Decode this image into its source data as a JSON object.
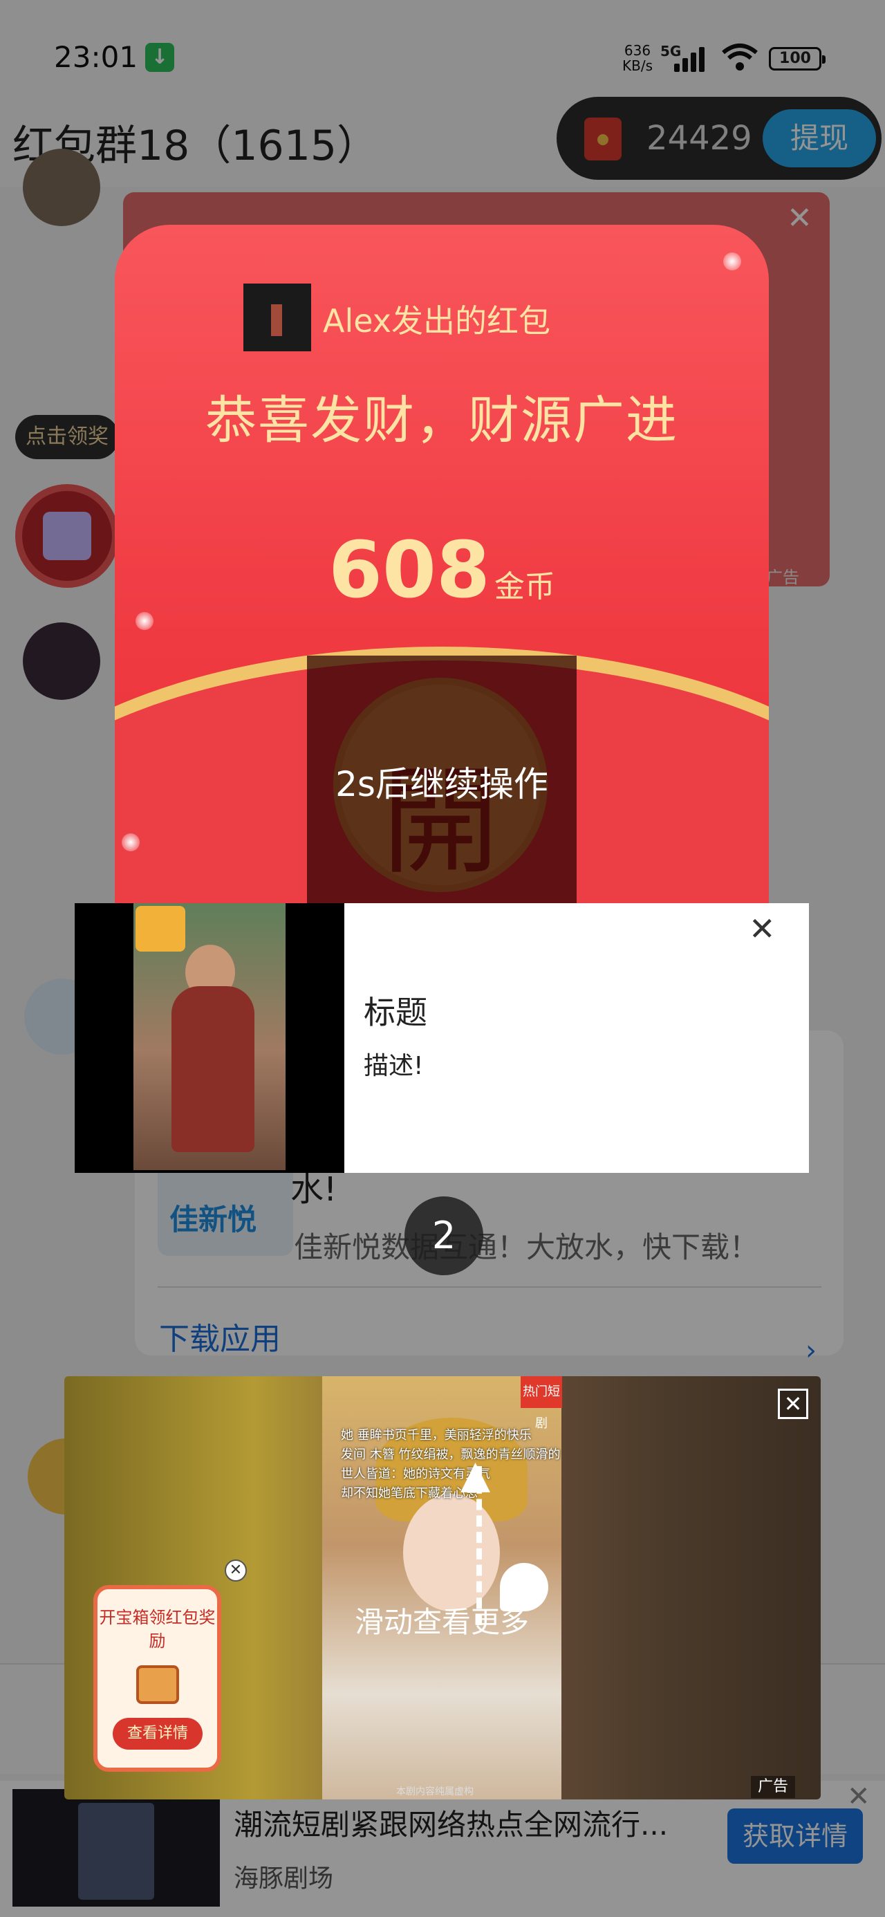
{
  "status_bar": {
    "time": "23:01",
    "download_indicator": "↓",
    "net_speed_value": "636",
    "net_speed_unit": "KB/s",
    "network_type": "5G",
    "battery": "100"
  },
  "header": {
    "title": "红包群18（1615）",
    "coin_count": "24429",
    "withdraw_label": "提现"
  },
  "chat": {
    "claim_bubble": "点击领奖",
    "ad_back_label": "广告"
  },
  "red_packet": {
    "sender": "Alex发出的红包",
    "greeting": "恭喜发财，财源广进",
    "amount": "608",
    "unit": "金币",
    "open_glyph": "開",
    "countdown_text": "2s后继续操作"
  },
  "middle_ad": {
    "title": "标题",
    "description": "描述!"
  },
  "countdown_number": "2",
  "app_card": {
    "logo_text": "佳新悦",
    "title_tail": "水!",
    "description": "佳新悦数据互通！大放水，快下载！",
    "download_label": "下载应用"
  },
  "swipe_ad": {
    "hot_tag": "热门短剧",
    "poem_lines": [
      "她  垂眸书页千里，美丽轻浮的快乐",
      "发间  木簪  竹纹绢被，飘逸的青丝顺滑的",
      "世人皆道：她的诗文有灵气",
      "却不知她笔底下藏着心思"
    ],
    "instruction": "滑动查看更多",
    "ad_label": "广告",
    "bottom_caption": "本剧内容纯属虚构"
  },
  "chest_card": {
    "title": "开宝箱领红包奖励",
    "button": "查看详情"
  },
  "banner_ad": {
    "title": "潮流短剧紧跟网络热点全网流行...",
    "source": "海豚剧场",
    "cta": "获取详情"
  },
  "colors": {
    "packet_red": "#f03a42",
    "packet_gold_text": "#fde3a4",
    "cta_blue": "#1a74e0",
    "withdraw_blue": "#27a6e8"
  }
}
